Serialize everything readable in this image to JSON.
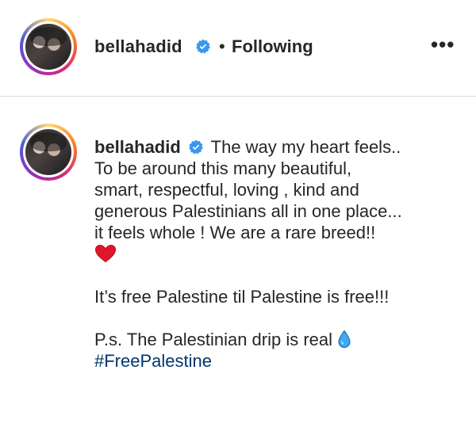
{
  "header": {
    "username": "bellahadid",
    "separator": "•",
    "follow_status": "Following",
    "more_label": "•••"
  },
  "caption": {
    "username": "bellahadid",
    "lines": [
      "The way my heart feels..",
      "To be around this many beautiful,",
      "smart, respectful, loving , kind and",
      "generous Palestinians all in one place...",
      "it feels whole ! We are a rare breed!!"
    ],
    "line2": "It’s free Palestine til Palestine is free!!!",
    "line3": "P.s. The Palestinian drip is real",
    "hashtag": "#FreePalestine"
  },
  "icons": {
    "verified": "verified-badge-icon",
    "heart": "red-heart-emoji",
    "drop": "droplet-emoji"
  },
  "colors": {
    "verified": "#3897f0",
    "hashtag": "#00376b",
    "heart": "#e0162b",
    "drop": "#3fa9f5"
  }
}
